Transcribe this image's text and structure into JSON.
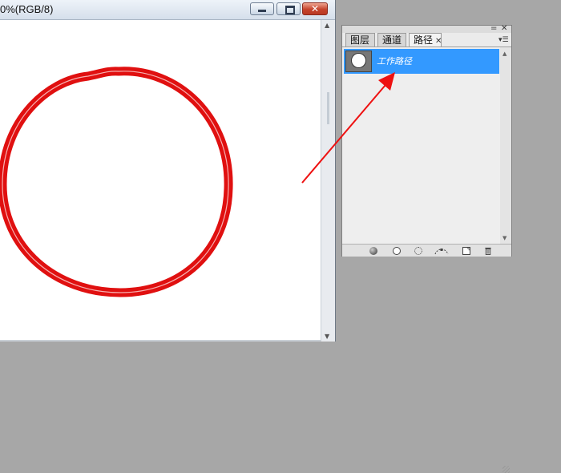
{
  "document": {
    "title": "0%(RGB/8)",
    "buttons": {
      "minimize": "",
      "maximize": "",
      "close": "✕"
    }
  },
  "panel": {
    "tabs": [
      {
        "label": "图层"
      },
      {
        "label": "通道"
      },
      {
        "label": "路径",
        "active": true,
        "close": "✕"
      }
    ],
    "controls": {
      "collapse": "=",
      "close": "✕",
      "menu": "▾☰"
    },
    "paths": [
      {
        "name": "工作路径",
        "selected": true
      }
    ],
    "footer_buttons": [
      "fill-path-icon",
      "stroke-path-icon",
      "load-selection-icon",
      "make-work-path-icon",
      "new-path-icon",
      "delete-path-icon"
    ]
  },
  "colors": {
    "circle_stroke": "#e01010",
    "selection_highlight": "#3399ff",
    "annotation_arrow": "#ee1111",
    "background": "#a7a7a7"
  }
}
